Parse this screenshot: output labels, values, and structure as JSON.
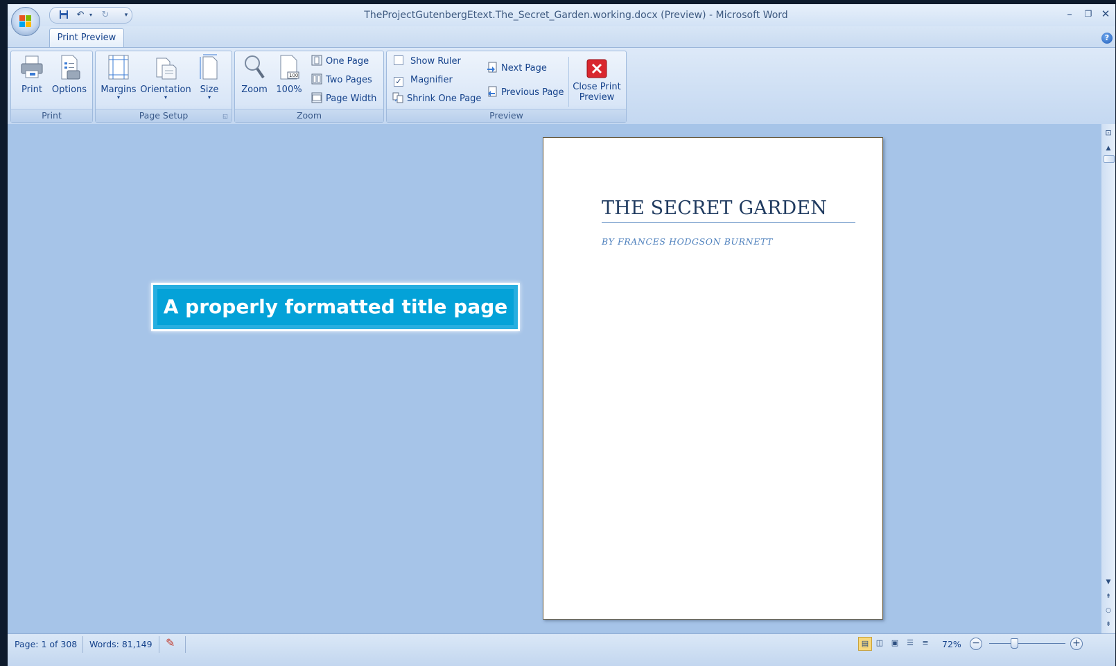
{
  "window": {
    "title": "TheProjectGutenbergEtext.The_Secret_Garden.working.docx (Preview) - Microsoft Word"
  },
  "quick_access": {
    "save_icon": "save-icon",
    "undo_icon": "undo-icon",
    "redo_icon": "redo-icon"
  },
  "tabs": [
    {
      "label": "Print Preview"
    }
  ],
  "ribbon": {
    "print_group": {
      "label": "Print",
      "print": "Print",
      "options": "Options"
    },
    "page_setup_group": {
      "label": "Page Setup",
      "margins": "Margins",
      "orientation": "Orientation",
      "size": "Size"
    },
    "zoom_group": {
      "label": "Zoom",
      "zoom": "Zoom",
      "hundred": "100%",
      "one_page": "One Page",
      "two_pages": "Two Pages",
      "page_width": "Page Width"
    },
    "preview_group": {
      "label": "Preview",
      "show_ruler": "Show Ruler",
      "show_ruler_checked": false,
      "magnifier": "Magnifier",
      "magnifier_checked": true,
      "shrink_one_page": "Shrink One Page",
      "next_page": "Next Page",
      "previous_page": "Previous Page",
      "close_print_preview_line1": "Close Print",
      "close_print_preview_line2": "Preview"
    }
  },
  "document": {
    "title": "THE SECRET GARDEN",
    "author": "BY FRANCES HODGSON BURNETT"
  },
  "callout": {
    "text": "A properly formatted title page"
  },
  "status": {
    "page": "Page: 1 of 308",
    "words": "Words: 81,149",
    "zoom": "72%"
  },
  "colors": {
    "accent": "#04a2d8",
    "heading": "#1f3a5f",
    "author": "#4f81bd",
    "background": "#a6c4e8"
  }
}
